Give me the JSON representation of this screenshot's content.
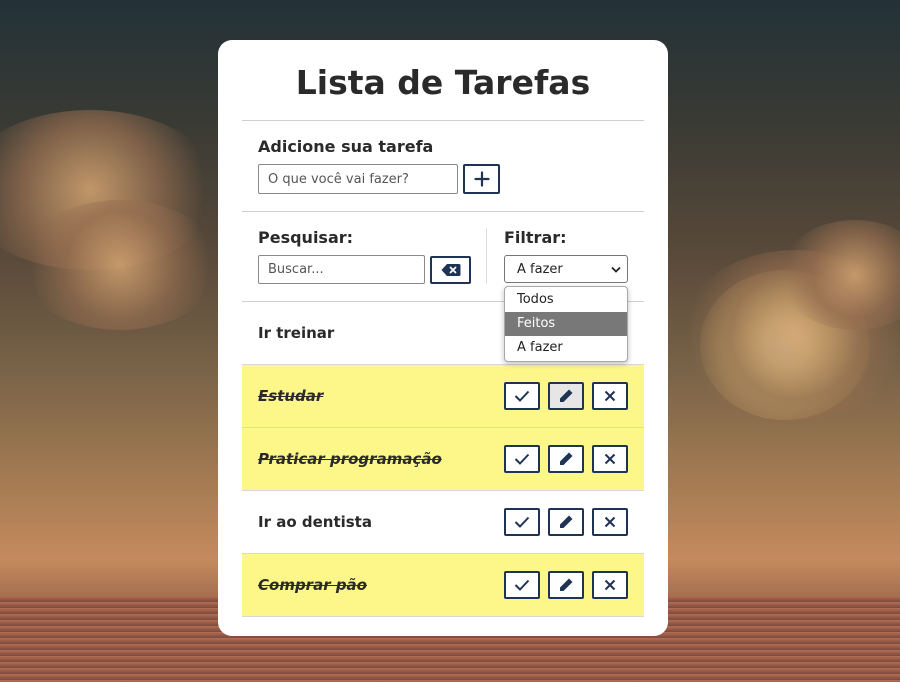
{
  "app": {
    "title": "Lista de Tarefas"
  },
  "add": {
    "label": "Adicione sua tarefa",
    "placeholder": "O que você vai fazer?",
    "button_icon": "plus-icon"
  },
  "search": {
    "label": "Pesquisar:",
    "placeholder": "Buscar...",
    "clear_icon": "backspace-icon"
  },
  "filter": {
    "label": "Filtrar:",
    "selected": "A fazer",
    "options": [
      "Todos",
      "Feitos",
      "A fazer"
    ],
    "highlighted": "Feitos"
  },
  "todos": [
    {
      "text": "Ir treinar",
      "done": false
    },
    {
      "text": "Estudar",
      "done": true
    },
    {
      "text": "Praticar programação",
      "done": true
    },
    {
      "text": "Ir ao dentista",
      "done": false
    },
    {
      "text": "Comprar pão",
      "done": true
    }
  ],
  "icons": {
    "finish": "check-icon",
    "edit": "pencil-icon",
    "remove": "x-icon"
  },
  "colors": {
    "accent": "#1f3354",
    "done_bg": "#fdf78a",
    "card_bg": "#ffffff"
  }
}
